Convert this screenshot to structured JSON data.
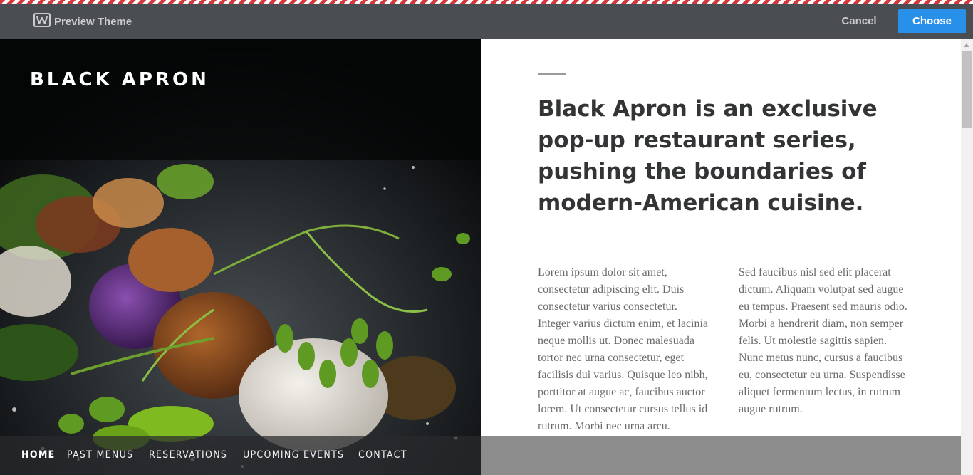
{
  "topbar": {
    "brand_icon": "weebly-w-icon",
    "brand_label": "Preview Theme",
    "cancel_label": "Cancel",
    "choose_label": "Choose",
    "colors": {
      "bar": "#4a4e53",
      "choose": "#2990ea"
    }
  },
  "site": {
    "title": "BLACK APRON",
    "hero_image": "plated-food-photo"
  },
  "nav": {
    "items": [
      {
        "label": "HOME"
      },
      {
        "label": "PAST MENUS"
      },
      {
        "label": "RESERVATIONS"
      },
      {
        "label": "UPCOMING EVENTS"
      },
      {
        "label": "CONTACT"
      }
    ]
  },
  "content": {
    "headline": "Black Apron is an exclusive pop-up restaurant series, pushing the boundaries of modern-American cuisine.",
    "column1": "Lorem ipsum dolor sit amet, consectetur adipiscing elit. Duis consectetur varius consectetur. Integer varius dictum enim, et lacinia neque mollis ut. Donec malesuada tortor nec urna consectetur, eget facilisis dui varius. Quisque leo nibh, porttitor at augue ac, faucibus auctor lorem. Ut consectetur cursus tellus id rutrum. Morbi nec urna arcu.",
    "column2": "Sed faucibus nisl sed elit placerat dictum. Aliquam volutpat sed augue eu tempus. Praesent sed mauris odio. Morbi a hendrerit diam, non semper felis. Ut molestie sagittis sapien. Nunc metus nunc, cursus a faucibus eu, consectetur eu urna. Suspendisse aliquet fermentum lectus, in rutrum augue rutrum."
  }
}
